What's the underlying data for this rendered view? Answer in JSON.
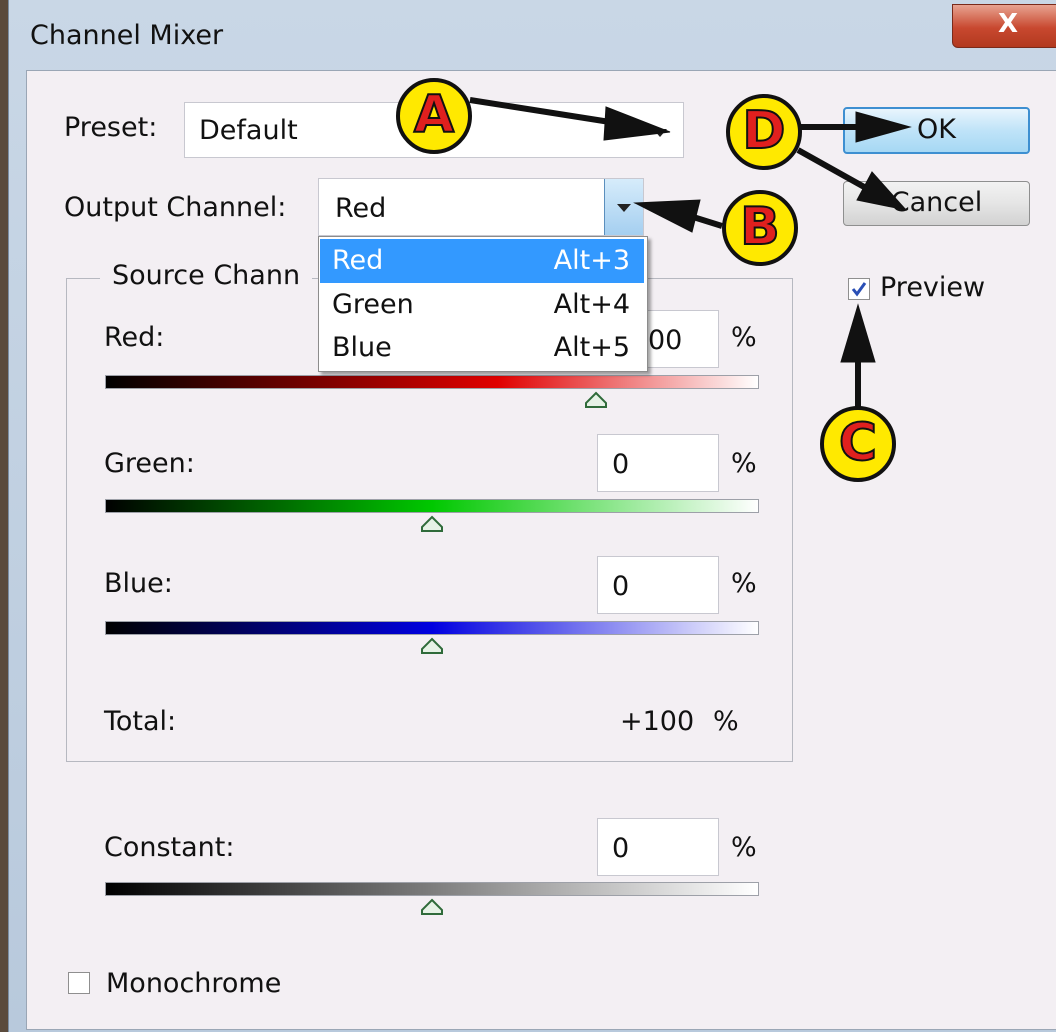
{
  "window": {
    "title": "Channel Mixer",
    "close_glyph": "X"
  },
  "preset": {
    "label": "Preset:",
    "value": "Default"
  },
  "output_channel": {
    "label": "Output Channel:",
    "value": "Red"
  },
  "buttons": {
    "ok": "OK",
    "cancel": "Cancel"
  },
  "preview": {
    "label": "Preview",
    "checked": true
  },
  "source_channels": {
    "legend": "Source Chann",
    "red": {
      "label": "Red:",
      "value": "00",
      "unit": "%",
      "level": 100
    },
    "green": {
      "label": "Green:",
      "value": "0",
      "unit": "%",
      "level": 0
    },
    "blue": {
      "label": "Blue:",
      "value": "0",
      "unit": "%",
      "level": 0
    },
    "total": {
      "label": "Total:",
      "value": "+100",
      "unit": "%"
    }
  },
  "constant": {
    "label": "Constant:",
    "value": "0",
    "unit": "%",
    "level": 0
  },
  "monochrome": {
    "label": "Monochrome",
    "checked": false
  },
  "dropdown": {
    "options": [
      {
        "name": "Red",
        "shortcut": "Alt+3",
        "selected": true
      },
      {
        "name": "Green",
        "shortcut": "Alt+4",
        "selected": false
      },
      {
        "name": "Blue",
        "shortcut": "Alt+5",
        "selected": false
      }
    ]
  },
  "annotations": {
    "a": "A",
    "b": "B",
    "c": "C",
    "d": "D"
  },
  "colors": {
    "selection": "#3399ff",
    "badge_fill": "#ffe900",
    "badge_letter": "#e0201e",
    "ok_border": "#3d8fd1"
  }
}
